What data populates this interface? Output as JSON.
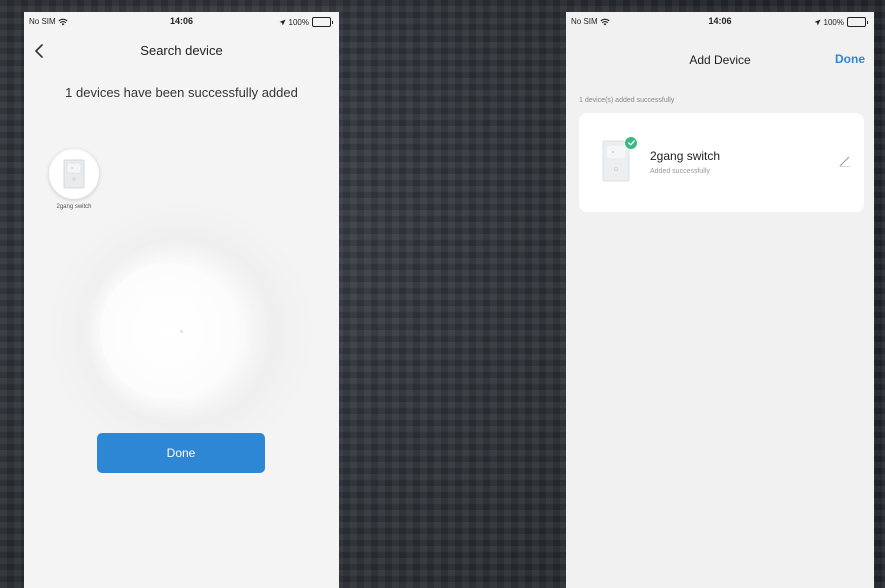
{
  "status_bar": {
    "carrier": "No SIM",
    "time": "14:06",
    "battery": "100%",
    "battery_level": 1.0
  },
  "search_screen": {
    "title": "Search device",
    "message": "1 devices have been successfully added",
    "found_device_label": "2gang switch",
    "done_label": "Done"
  },
  "add_screen": {
    "title": "Add Device",
    "done_label": "Done",
    "section_header": "1 device(s) added successfully",
    "devices": [
      {
        "name": "2gang switch",
        "status": "Added successfully"
      }
    ]
  },
  "colors": {
    "accent": "#2d87d4",
    "success": "#39b983",
    "screen_bg": "#f4f4f4",
    "card_bg": "#ffffff"
  },
  "icons": [
    "back-chevron-icon",
    "wifi-icon",
    "location-arrow-icon",
    "battery-icon",
    "switch-device-icon",
    "check-badge-icon",
    "pencil-icon"
  ]
}
